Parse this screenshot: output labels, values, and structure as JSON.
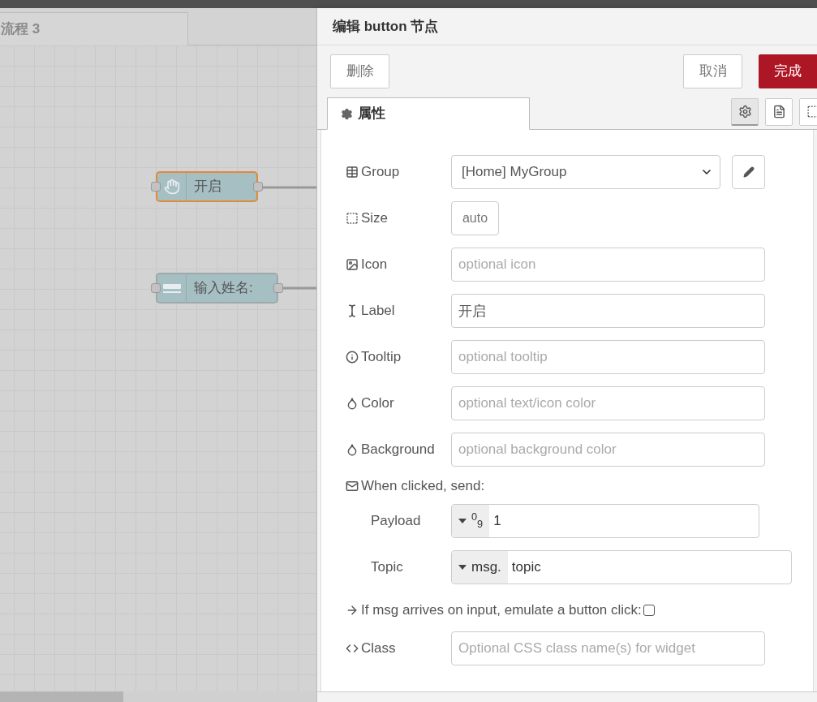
{
  "canvas": {
    "tab": "流程 3",
    "nodes": [
      {
        "kind": "button",
        "label": "开启",
        "selected": true
      },
      {
        "kind": "text_input",
        "label": "输入姓名:",
        "selected": false
      }
    ]
  },
  "dialog": {
    "title": "编辑 button 节点",
    "delete": "删除",
    "cancel": "取消",
    "done": "完成",
    "tabs": [
      {
        "label": "属性",
        "selected": true
      }
    ],
    "icon_tabs": [
      {
        "selected": true
      },
      {
        "selected": false
      },
      {
        "selected": false
      }
    ],
    "fields": [
      {
        "kind": "select",
        "label": "Group",
        "value": "[Home] MyGroup"
      },
      {
        "kind": "size",
        "label": "Size",
        "value": "auto"
      },
      {
        "kind": "text",
        "label": "Icon",
        "placeholder": "optional icon"
      },
      {
        "kind": "text",
        "label": "Label",
        "value": "开启"
      },
      {
        "kind": "text",
        "label": "Tooltip",
        "placeholder": "optional tooltip"
      },
      {
        "kind": "text",
        "label": "Color",
        "placeholder": "optional text/icon color"
      },
      {
        "kind": "text",
        "label": "Background",
        "placeholder": "optional background color"
      },
      {
        "kind": "heading",
        "label": "When clicked, send:"
      },
      {
        "kind": "typed",
        "label": "Payload",
        "type_label": "$^{0}$$_{9}$",
        "value": "1"
      },
      {
        "kind": "typed",
        "label": "Topic",
        "type_label": "msg.",
        "value": "topic"
      },
      {
        "kind": "checkbox",
        "label": "If msg arrives on input, emulate a button click:",
        "checked": false
      },
      {
        "kind": "text",
        "label": "Class",
        "placeholder": "Optional CSS class name(s) for widget"
      }
    ]
  }
}
